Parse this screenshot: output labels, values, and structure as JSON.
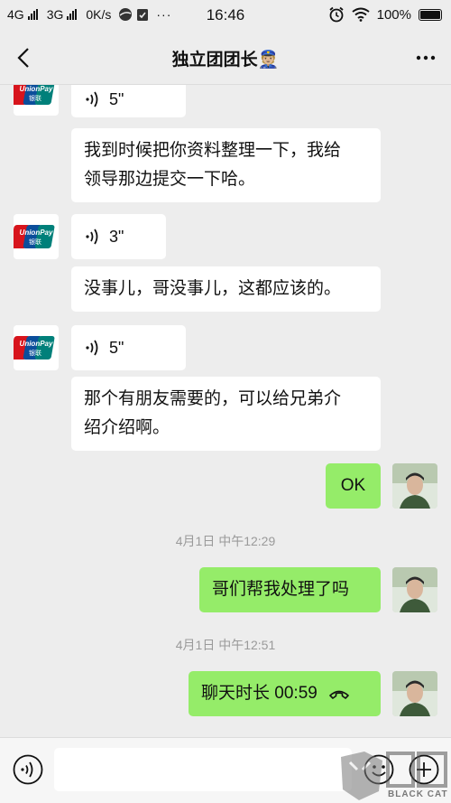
{
  "status_bar": {
    "network1": "4G",
    "network2": "3G",
    "speed": "0K/s",
    "dots": "···",
    "time": "16:46",
    "battery": "100%"
  },
  "nav": {
    "title": "独立团团长",
    "title_emoji": "👮🏼"
  },
  "messages": [
    {
      "type": "voice",
      "side": "in",
      "sender": "unionpay",
      "duration": "5\""
    },
    {
      "type": "text",
      "side": "in",
      "text_lines": [
        "我到时候把你资料整理一下，我给",
        "领导那边提交一下哈。"
      ]
    },
    {
      "type": "voice",
      "side": "in",
      "sender": "unionpay",
      "duration": "3\""
    },
    {
      "type": "text",
      "side": "in",
      "text_lines": [
        "没事儿，哥没事儿，这都应该的。"
      ]
    },
    {
      "type": "voice",
      "side": "in",
      "sender": "unionpay",
      "duration": "5\""
    },
    {
      "type": "text",
      "side": "in",
      "text_lines": [
        "那个有朋友需要的，可以给兄弟介",
        "绍介绍啊。"
      ]
    },
    {
      "type": "text",
      "side": "out",
      "text_lines": [
        "OK"
      ]
    },
    {
      "type": "timestamp",
      "text": "4月1日 中午12:29"
    },
    {
      "type": "text",
      "side": "out",
      "text_lines": [
        "哥们帮我处理了吗"
      ]
    },
    {
      "type": "timestamp",
      "text": "4月1日 中午12:51"
    },
    {
      "type": "call",
      "side": "out",
      "text": "聊天时长 00:59"
    }
  ],
  "unionpay_logo": {
    "line1": "UnionPay",
    "line2": "银联"
  },
  "input_bar": {
    "placeholder": ""
  },
  "watermark": {
    "text": "BLACK CAT"
  },
  "colors": {
    "background": "#ededed",
    "bubble_out": "#95ec69",
    "bubble_in": "#ffffff",
    "unionpay_red": "#d7141c",
    "unionpay_blue": "#0b4e9b",
    "unionpay_teal": "#00807a"
  }
}
